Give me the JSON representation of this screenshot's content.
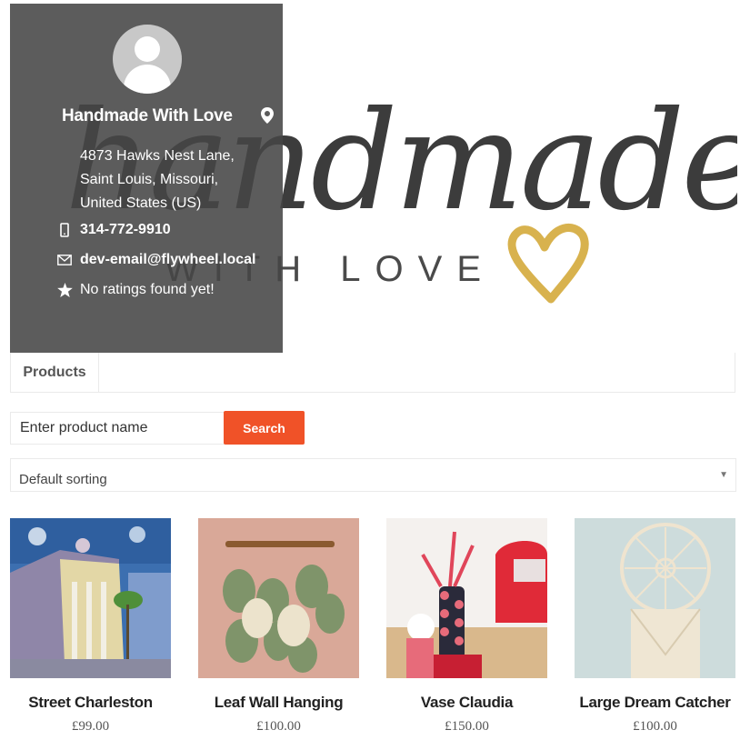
{
  "banner": {
    "logo_script": "handmade",
    "logo_subtitle": "WITH LOVE",
    "heart_color": "#d8b24e"
  },
  "store": {
    "name": "Handmade With Love",
    "address_lines": [
      "4873 Hawks Nest Lane,",
      "Saint Louis, Missouri,",
      "United States (US)"
    ],
    "phone": "314-772-9910",
    "email": "dev-email@flywheel.local",
    "rating": "No ratings found yet!",
    "icons": {
      "location": "map-pin-icon",
      "phone": "mobile-phone-icon",
      "email": "envelope-icon",
      "rating": "star-icon"
    }
  },
  "tabs": [
    {
      "label": "Products"
    }
  ],
  "search": {
    "placeholder": "Enter product name",
    "value": "",
    "button_label": "Search",
    "button_color": "#f05228"
  },
  "sort": {
    "selected": "Default sorting"
  },
  "products": [
    {
      "name": "Street Charleston",
      "price": "£99.00"
    },
    {
      "name": "Leaf Wall Hanging",
      "price": "£100.00"
    },
    {
      "name": "Vase Claudia",
      "price": "£150.00"
    },
    {
      "name": "Large Dream Catcher",
      "price": "£100.00"
    }
  ]
}
